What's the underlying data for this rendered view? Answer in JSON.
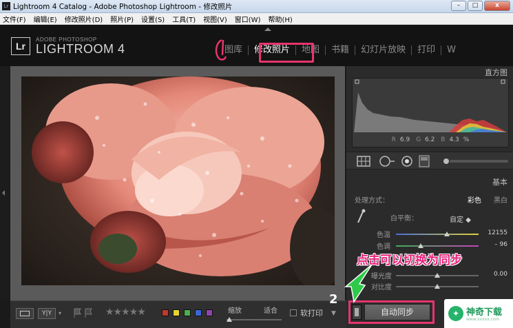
{
  "window": {
    "title": "Lightroom 4 Catalog - Adobe Photoshop Lightroom - 修改照片",
    "app_icon": "Lr",
    "buttons": {
      "minimize": "–",
      "maximize": "□",
      "close": "x"
    }
  },
  "menubar": {
    "items": [
      "文件(F)",
      "编辑(E)",
      "修改照片(D)",
      "照片(P)",
      "设置(S)",
      "工具(T)",
      "视图(V)",
      "窗口(W)",
      "帮助(H)"
    ]
  },
  "identity": {
    "badge": "Lr",
    "small": "ADOBE PHOTOSHOP",
    "big": "LIGHTROOM 4"
  },
  "modules": {
    "items": [
      {
        "label": "图库",
        "active": false
      },
      {
        "label": "修改照片",
        "active": true
      },
      {
        "label": "地图",
        "active": false
      },
      {
        "label": "书籍",
        "active": false
      },
      {
        "label": "幻灯片放映",
        "active": false
      },
      {
        "label": "打印",
        "active": false
      },
      {
        "label": "W",
        "active": false
      }
    ]
  },
  "right_panel": {
    "histogram_title": "直方图",
    "readout": {
      "r_label": "R",
      "r": "6.9",
      "g_label": "G",
      "g": "6.2",
      "b_label": "B",
      "b": "4.3",
      "unit": "%"
    },
    "basic_title": "基本",
    "treatment_label": "处理方式：",
    "treatment_color": "彩色",
    "treatment_bw": "黑白",
    "wb_label": "白平衡：",
    "wb_value": "自定",
    "temp_label": "色温",
    "temp_value": "12155",
    "temp_level": 0.62,
    "tint_label": "色调",
    "tint_value": "– 96",
    "tint_level": 0.3,
    "exposure_label": "曝光度",
    "exposure_value": "0.00",
    "exposure_level": 0.5,
    "contrast_label": "对比度",
    "contrast_level": 0.5
  },
  "toolbar": {
    "yy": "Y|Y",
    "stars": "★★★★★",
    "swatches": [
      "#c0392b",
      "#e5d430",
      "#4caf50",
      "#3a66d6",
      "#8e44ad"
    ],
    "zoom_fit_label": "缩放",
    "zoom_fill_label": "适合",
    "softproof_label": "软打印"
  },
  "sync": {
    "button_label": "自动同步"
  },
  "annotations": {
    "step_number": "2",
    "callout": "点击可以切换为同步"
  },
  "watermark": {
    "text": "神奇下载",
    "sub": "www.xxxxx.com"
  }
}
